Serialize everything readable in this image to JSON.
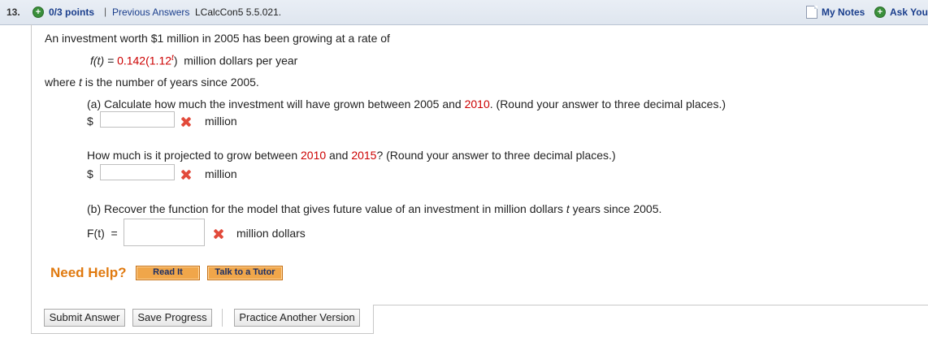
{
  "header": {
    "question_number": "13.",
    "points": "0/3 points",
    "separator": "|",
    "previous_answers": "Previous Answers",
    "problem_code": "LCalcCon5 5.5.021.",
    "my_notes": "My Notes",
    "ask_your_teacher": "Ask Your Teacher"
  },
  "problem": {
    "intro": "An investment worth $1 million in 2005 has been growing at a rate of",
    "formula": {
      "lhs": "f(t) = ",
      "coef": "0.142",
      "base_open": "(1.12",
      "exponent": "t",
      "close": ")",
      "suffix": "  million dollars per year"
    },
    "where_prefix": "where ",
    "where_var": "t",
    "where_suffix": " is the number of years since 2005."
  },
  "part_a": {
    "q1_prefix": "(a) Calculate how much the investment will have grown between 2005 and ",
    "q1_year": "2010",
    "q1_suffix": ". (Round your answer to three decimal places.)",
    "currency": "$",
    "unit": "million",
    "answer1_value": "",
    "q2_prefix": "How much is it projected to grow between ",
    "q2_year1": "2010",
    "q2_and": " and ",
    "q2_year2": "2015",
    "q2_suffix": "? (Round your answer to three decimal places.)",
    "answer2_value": ""
  },
  "part_b": {
    "q_prefix": "(b) Recover the function for the model that gives future value of an investment in million dollars ",
    "q_var": "t",
    "q_suffix": " years since 2005.",
    "label": "F(t)  =",
    "unit": "million dollars",
    "answer_value": ""
  },
  "help": {
    "need_help": "Need Help?",
    "read_it": "Read It",
    "talk_to_tutor": "Talk to a Tutor"
  },
  "actions": {
    "submit": "Submit Answer",
    "save": "Save Progress",
    "practice": "Practice Another Version"
  },
  "colors": {
    "incorrect_mark": "#e24a3b",
    "highlight_red": "#cc0000",
    "link_blue": "#1a3e8c",
    "help_orange": "#e07a10"
  }
}
